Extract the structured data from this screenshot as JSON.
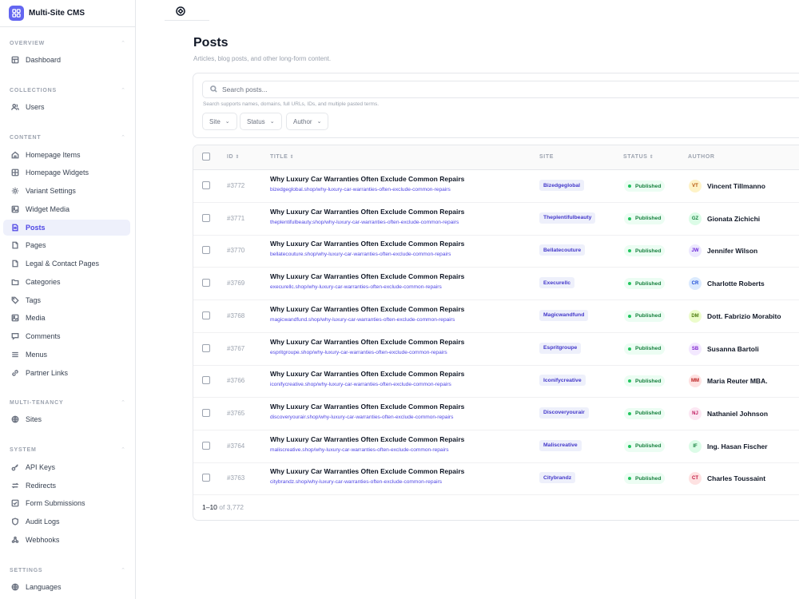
{
  "app": {
    "name": "Multi-Site CMS"
  },
  "sidebar": {
    "sections": [
      {
        "title": "OVERVIEW",
        "items": [
          {
            "label": "Dashboard",
            "icon": "dashboard-icon"
          }
        ]
      },
      {
        "title": "COLLECTIONS",
        "items": [
          {
            "label": "Users",
            "icon": "users-icon"
          }
        ]
      },
      {
        "title": "CONTENT",
        "items": [
          {
            "label": "Homepage Items",
            "icon": "home-icon"
          },
          {
            "label": "Homepage Widgets",
            "icon": "widgets-icon"
          },
          {
            "label": "Variant Settings",
            "icon": "sun-icon"
          },
          {
            "label": "Widget Media",
            "icon": "image-icon"
          },
          {
            "label": "Posts",
            "icon": "document-icon",
            "active": true
          },
          {
            "label": "Pages",
            "icon": "page-icon"
          },
          {
            "label": "Legal & Contact Pages",
            "icon": "page-icon"
          },
          {
            "label": "Categories",
            "icon": "folder-icon"
          },
          {
            "label": "Tags",
            "icon": "tag-icon"
          },
          {
            "label": "Media",
            "icon": "image-icon"
          },
          {
            "label": "Comments",
            "icon": "comment-icon"
          },
          {
            "label": "Menus",
            "icon": "menu-icon"
          },
          {
            "label": "Partner Links",
            "icon": "link-icon"
          }
        ]
      },
      {
        "title": "MULTI-TENANCY",
        "items": [
          {
            "label": "Sites",
            "icon": "globe-icon"
          }
        ]
      },
      {
        "title": "SYSTEM",
        "items": [
          {
            "label": "API Keys",
            "icon": "key-icon"
          },
          {
            "label": "Redirects",
            "icon": "redirect-icon"
          },
          {
            "label": "Form Submissions",
            "icon": "checklist-icon"
          },
          {
            "label": "Audit Logs",
            "icon": "shield-icon"
          },
          {
            "label": "Webhooks",
            "icon": "webhook-icon"
          }
        ]
      },
      {
        "title": "SETTINGS",
        "items": [
          {
            "label": "Languages",
            "icon": "globe-icon"
          }
        ]
      }
    ]
  },
  "header": {
    "title": "Posts",
    "subtitle": "Articles, blog posts, and other long-form content."
  },
  "filters": {
    "search_placeholder": "Search posts...",
    "search_value": "",
    "search_hint": "Search supports names, domains, full URLs, IDs, and multiple pasted terms.",
    "site_label": "Site",
    "status_label": "Status",
    "author_label": "Author"
  },
  "table": {
    "columns": {
      "id": "ID",
      "title": "TITLE",
      "site": "SITE",
      "status": "STATUS",
      "author": "AUTHOR"
    },
    "rows": [
      {
        "id": "#3772",
        "title": "Why Luxury Car Warranties Often Exclude Common Repairs",
        "url": "bizedgeglobal.shop/why-luxury-car-warranties-often-exclude-common-repairs",
        "site": "Bizedgeglobal",
        "status": "Published",
        "initials": "VT",
        "author": "Vincent Tillmanno",
        "avatar_bg": "#fef3c7",
        "avatar_fg": "#b45309"
      },
      {
        "id": "#3771",
        "title": "Why Luxury Car Warranties Often Exclude Common Repairs",
        "url": "theplentifulbeauty.shop/why-luxury-car-warranties-often-exclude-common-repairs",
        "site": "Theplentifulbeauty",
        "status": "Published",
        "initials": "GZ",
        "author": "Gionata Zichichi",
        "avatar_bg": "#dcfce7",
        "avatar_fg": "#15803d"
      },
      {
        "id": "#3770",
        "title": "Why Luxury Car Warranties Often Exclude Common Repairs",
        "url": "bellatecouture.shop/why-luxury-car-warranties-often-exclude-common-repairs",
        "site": "Bellatecouture",
        "status": "Published",
        "initials": "JW",
        "author": "Jennifer Wilson",
        "avatar_bg": "#ede9fe",
        "avatar_fg": "#6d28d9"
      },
      {
        "id": "#3769",
        "title": "Why Luxury Car Warranties Often Exclude Common Repairs",
        "url": "execurellc.shop/why-luxury-car-warranties-often-exclude-common-repairs",
        "site": "Execurellc",
        "status": "Published",
        "initials": "CR",
        "author": "Charlotte Roberts",
        "avatar_bg": "#dbeafe",
        "avatar_fg": "#1d4ed8"
      },
      {
        "id": "#3768",
        "title": "Why Luxury Car Warranties Often Exclude Common Repairs",
        "url": "magicwandfund.shop/why-luxury-car-warranties-often-exclude-common-repairs",
        "site": "Magicwandfund",
        "status": "Published",
        "initials": "DM",
        "author": "Dott. Fabrizio Morabito",
        "avatar_bg": "#ecfccb",
        "avatar_fg": "#4d7c0f"
      },
      {
        "id": "#3767",
        "title": "Why Luxury Car Warranties Often Exclude Common Repairs",
        "url": "espritgroupe.shop/why-luxury-car-warranties-often-exclude-common-repairs",
        "site": "Espritgroupe",
        "status": "Published",
        "initials": "SB",
        "author": "Susanna Bartoli",
        "avatar_bg": "#f3e8ff",
        "avatar_fg": "#7e22ce"
      },
      {
        "id": "#3766",
        "title": "Why Luxury Car Warranties Often Exclude Common Repairs",
        "url": "iconifycreative.shop/why-luxury-car-warranties-often-exclude-common-repairs",
        "site": "Iconifycreative",
        "status": "Published",
        "initials": "MM",
        "author": "Maria Reuter MBA.",
        "avatar_bg": "#fee2e2",
        "avatar_fg": "#b91c1c"
      },
      {
        "id": "#3765",
        "title": "Why Luxury Car Warranties Often Exclude Common Repairs",
        "url": "discoveryourair.shop/why-luxury-car-warranties-often-exclude-common-repairs",
        "site": "Discoveryourair",
        "status": "Published",
        "initials": "NJ",
        "author": "Nathaniel Johnson",
        "avatar_bg": "#fce7f3",
        "avatar_fg": "#be185d"
      },
      {
        "id": "#3764",
        "title": "Why Luxury Car Warranties Often Exclude Common Repairs",
        "url": "maliscreative.shop/why-luxury-car-warranties-often-exclude-common-repairs",
        "site": "Maliscreative",
        "status": "Published",
        "initials": "IF",
        "author": "Ing. Hasan Fischer",
        "avatar_bg": "#dcfce7",
        "avatar_fg": "#15803d"
      },
      {
        "id": "#3763",
        "title": "Why Luxury Car Warranties Often Exclude Common Repairs",
        "url": "citybrandz.shop/why-luxury-car-warranties-often-exclude-common-repairs",
        "site": "Citybrandz",
        "status": "Published",
        "initials": "CT",
        "author": "Charles Toussaint",
        "avatar_bg": "#fee2e2",
        "avatar_fg": "#be123c"
      }
    ]
  },
  "pagination": {
    "range": "1–10",
    "of_text": "of 3,772"
  },
  "colors": {
    "accent": "#4f46e5",
    "published_green": "#15803d"
  }
}
